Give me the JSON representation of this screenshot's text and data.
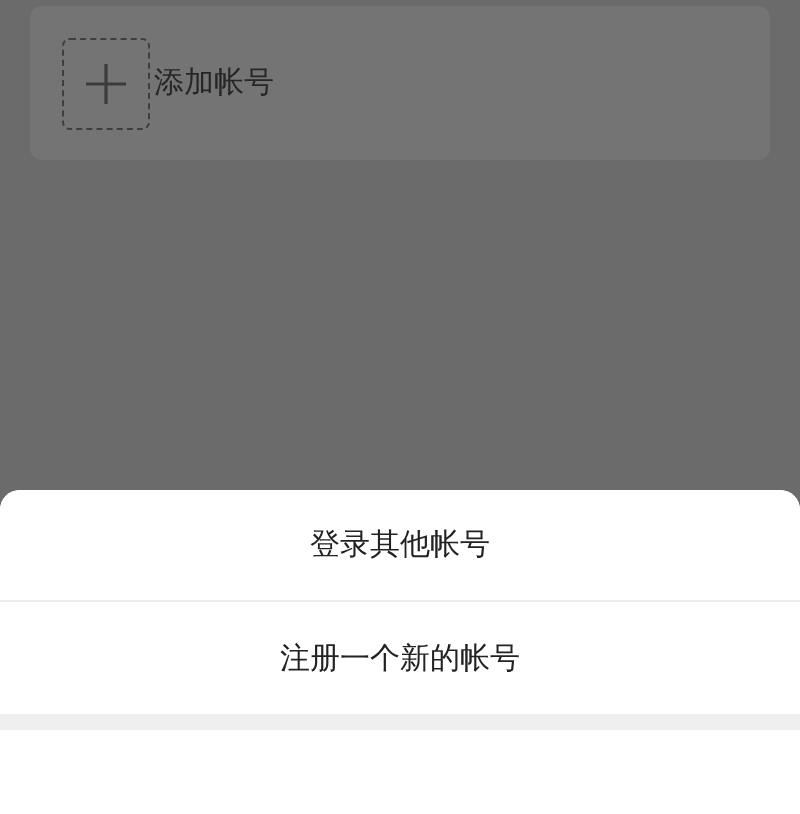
{
  "account_card": {
    "label": "添加帐号"
  },
  "sheet": {
    "options": [
      {
        "label": "登录其他帐号"
      },
      {
        "label": "注册一个新的帐号"
      }
    ]
  }
}
